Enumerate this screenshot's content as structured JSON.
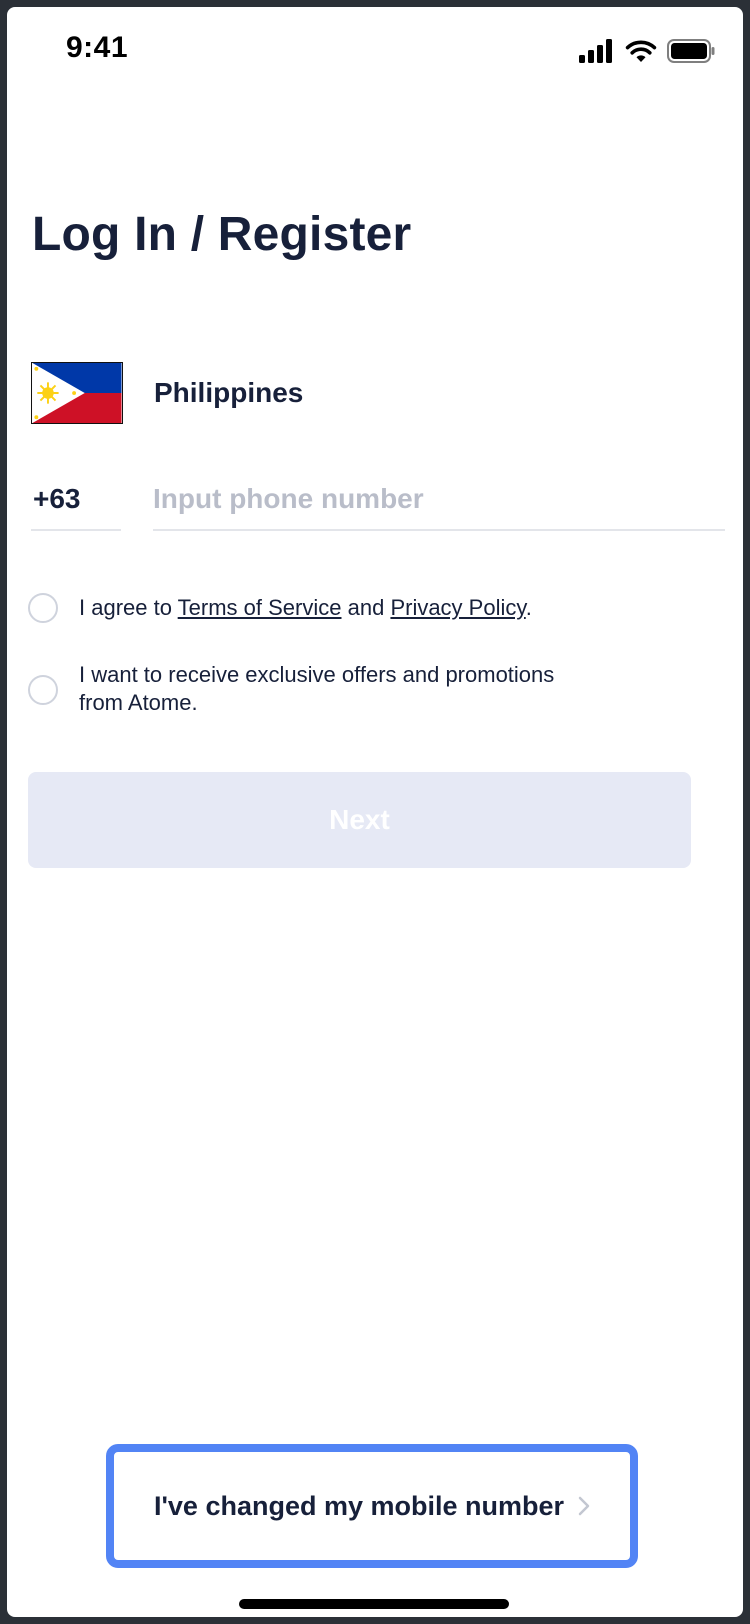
{
  "status_bar": {
    "time": "9:41",
    "icons": [
      "cellular-signal-icon",
      "wifi-icon",
      "battery-icon"
    ]
  },
  "title": "Log In / Register",
  "country": {
    "name": "Philippines",
    "flag": "philippines-flag-icon"
  },
  "phone": {
    "dial_code": "+63",
    "placeholder": "Input phone number",
    "value": ""
  },
  "consents": {
    "terms": {
      "prefix": "I agree to ",
      "terms_link": "Terms of Service",
      "middle": " and ",
      "privacy_link": "Privacy Policy",
      "suffix": ".",
      "checked": false
    },
    "marketing": {
      "line1": "I want to receive exclusive offers and promotions",
      "line2": "from Atome.",
      "checked": false
    }
  },
  "next_button": {
    "label": "Next",
    "enabled": false
  },
  "changed_number_button": {
    "label": "I've changed my mobile number"
  },
  "colors": {
    "text": "#17203a",
    "placeholder": "#b9bdc9",
    "disabled_button": "#e6e9f5",
    "highlight_border": "#5284f5"
  }
}
